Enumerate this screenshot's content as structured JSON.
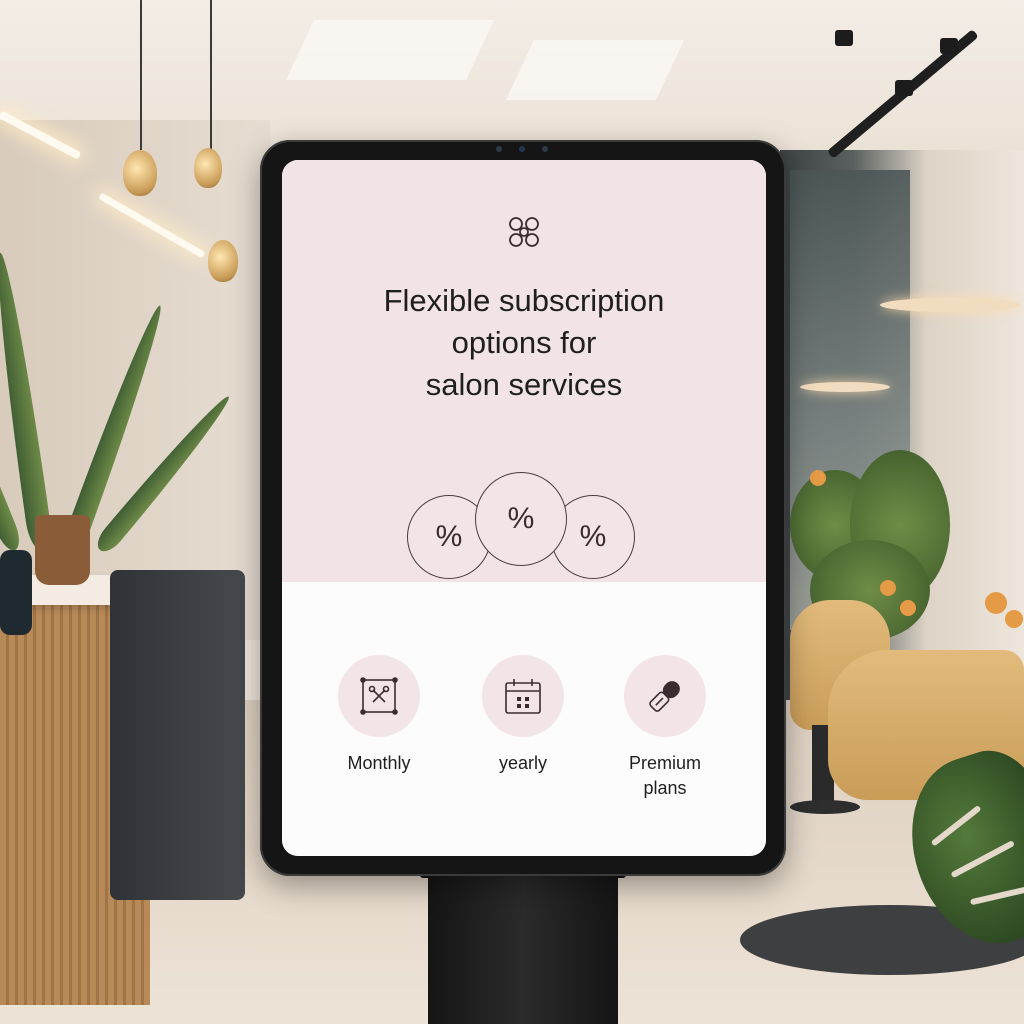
{
  "kiosk": {
    "hero": {
      "brand_icon": "flower-knot-icon",
      "headline_lines": [
        "Flexible subscription",
        "options for",
        "salon services"
      ],
      "badges": [
        {
          "icon": "percent-icon",
          "text": "%"
        },
        {
          "icon": "percent-icon",
          "text": "%"
        },
        {
          "icon": "percent-icon",
          "text": "%"
        }
      ]
    },
    "options": [
      {
        "icon": "scissors-frame-icon",
        "label": "Monthly"
      },
      {
        "icon": "calendar-icon",
        "label": "yearly"
      },
      {
        "icon": "nail-polish-icon",
        "label_lines": [
          "Premium",
          "plans"
        ]
      }
    ],
    "colors": {
      "hero_bg": "#f2e3e7",
      "badge_bg": "#f3e4e7",
      "screen_bg": "#fcfcfc",
      "text": "#1f1f1f",
      "bezel": "#151515"
    }
  }
}
